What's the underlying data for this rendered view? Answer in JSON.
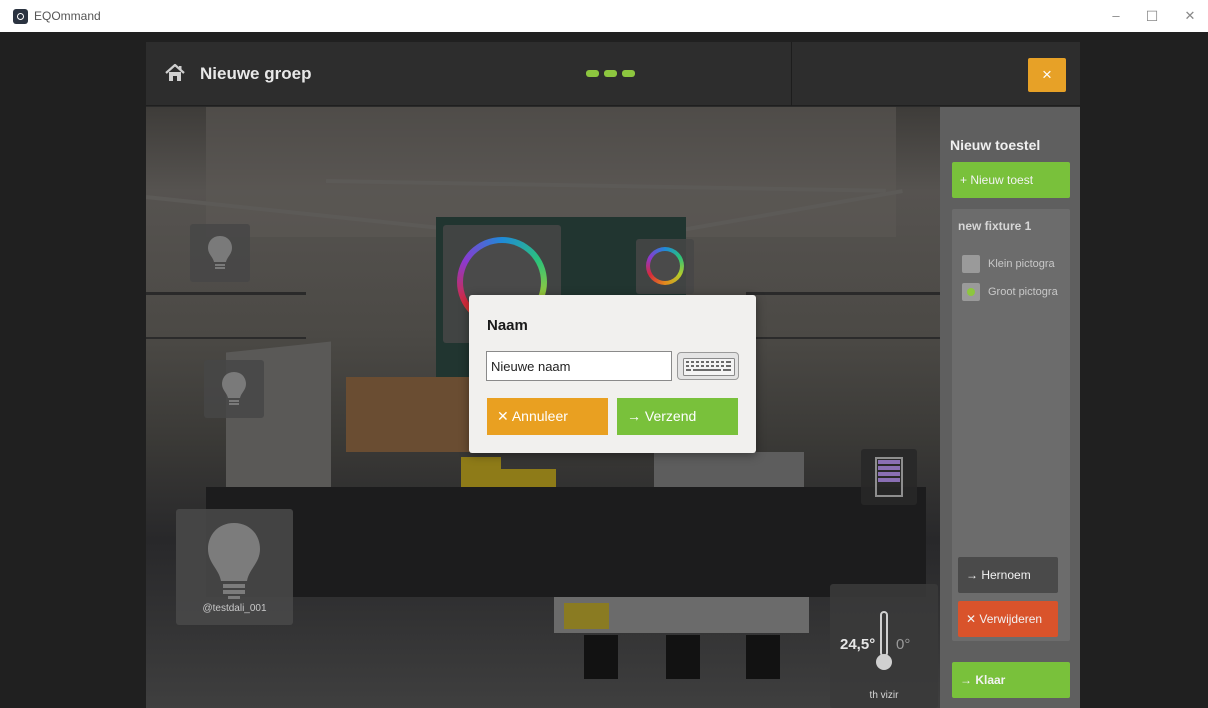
{
  "window": {
    "app_title": "EQOmmand",
    "controls": {
      "minimize": "–",
      "maximize": "☐",
      "close": "✕"
    }
  },
  "header": {
    "title": "Nieuwe groep",
    "close_glyph": "×",
    "page_indicator": {
      "count": 3,
      "active_color": "#8dc63f"
    }
  },
  "scene": {
    "fixtures": [
      {
        "type": "bulb",
        "icon": "lightbulb-icon"
      },
      {
        "type": "bulb",
        "icon": "lightbulb-icon"
      },
      {
        "type": "color-wheel",
        "icon": "color-wheel-icon"
      },
      {
        "type": "color-wheel",
        "icon": "color-wheel-icon"
      },
      {
        "type": "blind",
        "icon": "blind-icon"
      },
      {
        "type": "bulb-large",
        "icon": "lightbulb-icon",
        "caption": "@testdali_001"
      }
    ],
    "thermostat": {
      "temperature": "24,5°",
      "setpoint": "0°",
      "caption": "th vizir",
      "icon": "thermometer-icon"
    }
  },
  "side_panel": {
    "title": "Nieuw toestel",
    "new_device_button": "+ Nieuw toest",
    "fixture": {
      "name": "new fixture 1",
      "options": [
        {
          "label": "Klein pictogra",
          "selected": false
        },
        {
          "label": "Groot pictogra",
          "selected": true
        }
      ]
    },
    "rename_button": "→  Hernoem",
    "delete_button": "✕  Verwijderen",
    "done_button": "→  Klaar"
  },
  "dialog": {
    "title": "Naam",
    "input_value": "Nieuwe naam",
    "cancel_label": "✕  Annuleer",
    "send_label": "→  Verzend"
  },
  "colors": {
    "accent_green": "#79c13b",
    "accent_orange": "#e9a021",
    "delete_red": "#d9532b"
  }
}
